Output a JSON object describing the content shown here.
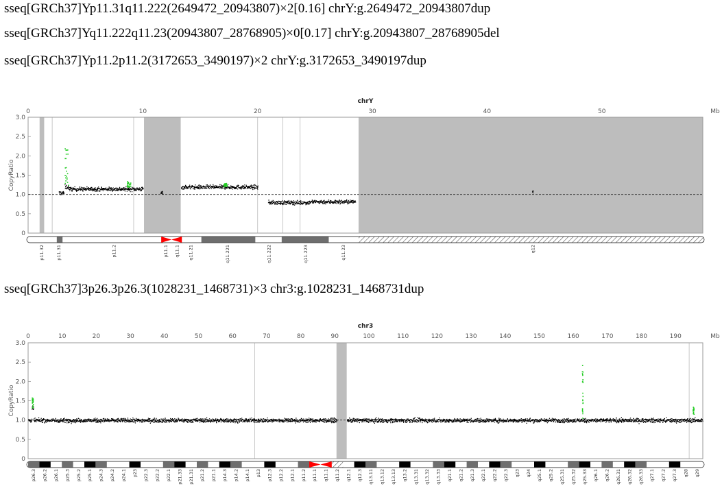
{
  "text_lines": [
    "sseq[GRCh37]Yp11.31q11.222(2649472_20943807)×2[0.16] chrY:g.2649472_20943807dup",
    "sseq[GRCh37]Yq11.222q11.23(20943807_28768905)×0[0.17] chrY:g.20943807_28768905del",
    "sseq[GRCh37]Yp11.2p11.2(3172653_3490197)×2 chrY:g.3172653_3490197dup",
    "sseq[GRCh37]3p26.3p26.3(1028231_1468731)×3 chr3:g.1028231_1468731dup"
  ],
  "colors": {
    "data_point": "#000000",
    "highlight_point": "#22cc22",
    "masked_region": "#bdbdbd",
    "centromere": "#ff0000",
    "band_dark": "#6e6e6e",
    "band_black": "#000000",
    "band_light": "#ffffff"
  },
  "chart_data": [
    {
      "type": "scatter",
      "title": "chrY",
      "ylabel": "CopyRatio",
      "x_unit": "Mb",
      "xlim": [
        0,
        58.8
      ],
      "ylim": [
        0,
        3.0
      ],
      "x_ticks": [
        "0",
        "10",
        "20",
        "30",
        "40",
        "50"
      ],
      "y_ticks": [
        "0",
        "0.5",
        "1.0",
        "1.5",
        "2.0",
        "2.5",
        "3.0"
      ],
      "reference_line": 1.0,
      "masked_regions": [
        [
          1.0,
          1.4
        ],
        [
          10.1,
          13.3
        ],
        [
          28.8,
          59.0
        ]
      ],
      "gap_lines": [
        2.1,
        9.2,
        20.0,
        22.2,
        23.7
      ],
      "segments": [
        {
          "x0": 2.65,
          "x1": 3.1,
          "y": 1.05
        },
        {
          "x0": 3.17,
          "x1": 3.49,
          "y": 1.2
        },
        {
          "x0": 3.5,
          "x1": 10.0,
          "y": 1.15
        },
        {
          "x0": 11.5,
          "x1": 11.7,
          "y": 1.05
        },
        {
          "x0": 13.3,
          "x1": 20.0,
          "y": 1.2
        },
        {
          "x0": 20.9,
          "x1": 24.5,
          "y": 0.8
        },
        {
          "x0": 24.5,
          "x1": 28.5,
          "y": 0.82
        },
        {
          "x0": 43.9,
          "x1": 44.0,
          "y": 1.1
        }
      ],
      "highlights": [
        {
          "x0": 3.17,
          "x1": 3.49,
          "y_from": 1.2,
          "y_to": 2.2
        },
        {
          "x0": 8.6,
          "x1": 8.9,
          "y_from": 1.2,
          "y_to": 1.35
        },
        {
          "x0": 17.0,
          "x1": 17.3,
          "y_from": 1.2,
          "y_to": 1.3
        }
      ],
      "ideogram": {
        "bands": [
          {
            "start": 0,
            "end": 2.5,
            "stain": "light"
          },
          {
            "start": 2.5,
            "end": 3.0,
            "stain": "dark"
          },
          {
            "start": 3.0,
            "end": 11.6,
            "stain": "light"
          },
          {
            "start": 11.6,
            "end": 12.5,
            "stain": "centromere_p"
          },
          {
            "start": 12.5,
            "end": 13.4,
            "stain": "centromere_q"
          },
          {
            "start": 13.4,
            "end": 15.1,
            "stain": "light"
          },
          {
            "start": 15.1,
            "end": 19.8,
            "stain": "dark"
          },
          {
            "start": 19.8,
            "end": 22.1,
            "stain": "light"
          },
          {
            "start": 22.1,
            "end": 26.2,
            "stain": "dark"
          },
          {
            "start": 26.2,
            "end": 28.8,
            "stain": "light"
          },
          {
            "start": 28.8,
            "end": 59.0,
            "stain": "stalk"
          }
        ],
        "labels": [
          {
            "pos": 1.2,
            "text": "p11.32"
          },
          {
            "pos": 2.7,
            "text": "p11.31"
          },
          {
            "pos": 7.5,
            "text": "p11.2"
          },
          {
            "pos": 12.0,
            "text": "p11.1"
          },
          {
            "pos": 13.0,
            "text": "q11.1"
          },
          {
            "pos": 14.2,
            "text": "q11.21"
          },
          {
            "pos": 17.4,
            "text": "q11.221"
          },
          {
            "pos": 21.0,
            "text": "q11.222"
          },
          {
            "pos": 24.2,
            "text": "q11.223"
          },
          {
            "pos": 27.5,
            "text": "q11.23"
          },
          {
            "pos": 44.0,
            "text": "q12"
          }
        ]
      }
    },
    {
      "type": "scatter",
      "title": "chr3",
      "ylabel": "CopyRatio",
      "x_unit": "Mb",
      "xlim": [
        0,
        198.0
      ],
      "ylim": [
        0,
        3.0
      ],
      "x_ticks": [
        "0",
        "10",
        "20",
        "30",
        "40",
        "50",
        "60",
        "70",
        "80",
        "90",
        "100",
        "110",
        "120",
        "130",
        "140",
        "150",
        "160",
        "170",
        "180",
        "190"
      ],
      "y_ticks": [
        "0",
        "0.5",
        "1.0",
        "1.5",
        "2.0",
        "2.5",
        "3.0"
      ],
      "reference_line": 1.0,
      "masked_regions": [
        [
          90.5,
          93.5
        ]
      ],
      "gap_lines": [
        66.5,
        194.0
      ],
      "segments": [
        {
          "x0": 0.0,
          "x1": 1.0,
          "y": 1.0
        },
        {
          "x0": 1.0,
          "x1": 1.47,
          "y": 1.3
        },
        {
          "x0": 1.47,
          "x1": 90.5,
          "y": 1.0
        },
        {
          "x0": 93.5,
          "x1": 197.9,
          "y": 1.0
        }
      ],
      "highlights": [
        {
          "x0": 1.03,
          "x1": 1.47,
          "y_from": 1.3,
          "y_to": 1.6
        },
        {
          "x0": 162.5,
          "x1": 162.7,
          "y_from": 1.0,
          "y_to": 2.45
        },
        {
          "x0": 195.0,
          "x1": 195.3,
          "y_from": 1.15,
          "y_to": 1.35
        }
      ],
      "ideogram": {
        "labels": [
          "p26.3",
          "p26.2",
          "p26.1",
          "p25.3",
          "p25.2",
          "p25.1",
          "p24.3",
          "p24.2",
          "p24.1",
          "p23",
          "p22.3",
          "p22.2",
          "p22.1",
          "p21.33",
          "p21.31",
          "p21.2",
          "p21.1",
          "p14.3",
          "p14.2",
          "p14.1",
          "p13",
          "p12.3",
          "p12.2",
          "p12.1",
          "p11.2",
          "p11.1",
          "q11.1",
          "q11.2",
          "q12.1",
          "q12.3",
          "q13.11",
          "q13.12",
          "q13.13",
          "q13.2",
          "q13.31",
          "q13.32",
          "q13.33",
          "q21.1",
          "q21.2",
          "q21.3",
          "q22.1",
          "q22.2",
          "q22.3",
          "q23",
          "q24",
          "q25.1",
          "q25.2",
          "q25.31",
          "q25.32",
          "q25.33",
          "q26.1",
          "q26.2",
          "q26.31",
          "q26.32",
          "q26.33",
          "q27.1",
          "q27.2",
          "q27.3",
          "q28",
          "q29"
        ]
      }
    }
  ]
}
